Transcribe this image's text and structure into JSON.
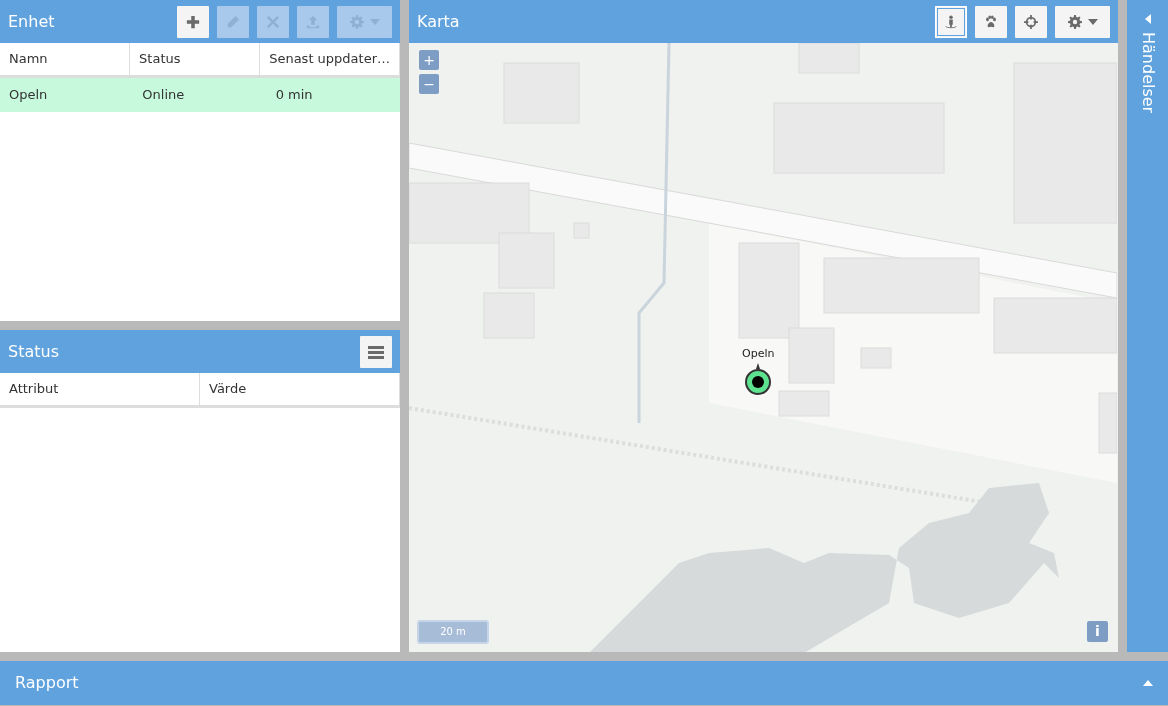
{
  "devices": {
    "title": "Enhet",
    "toolbar": [
      {
        "kind": "add",
        "disabled": false
      },
      {
        "kind": "edit",
        "disabled": true
      },
      {
        "kind": "remove",
        "disabled": true
      },
      {
        "kind": "upload",
        "disabled": true
      },
      {
        "kind": "settings",
        "disabled": true
      }
    ],
    "columns": [
      "Namn",
      "Status",
      "Senast uppdater…"
    ],
    "rows": [
      {
        "cells": [
          "Opeln",
          "Online",
          "0 min"
        ],
        "selected": true
      }
    ]
  },
  "status": {
    "title": "Status",
    "columns": [
      "Attribut",
      "Värde"
    ]
  },
  "map": {
    "title": "Karta",
    "toolbar": [
      {
        "kind": "person",
        "selected": true
      },
      {
        "kind": "paw",
        "selected": false
      },
      {
        "kind": "crosshair",
        "selected": false
      },
      {
        "kind": "settings",
        "selected": false
      }
    ],
    "zoom": [
      "+",
      "−"
    ],
    "marker_label": "Opeln",
    "scale": "20 m",
    "info": "i"
  },
  "events": {
    "title": "Händelser"
  },
  "report": {
    "title": "Rapport"
  }
}
